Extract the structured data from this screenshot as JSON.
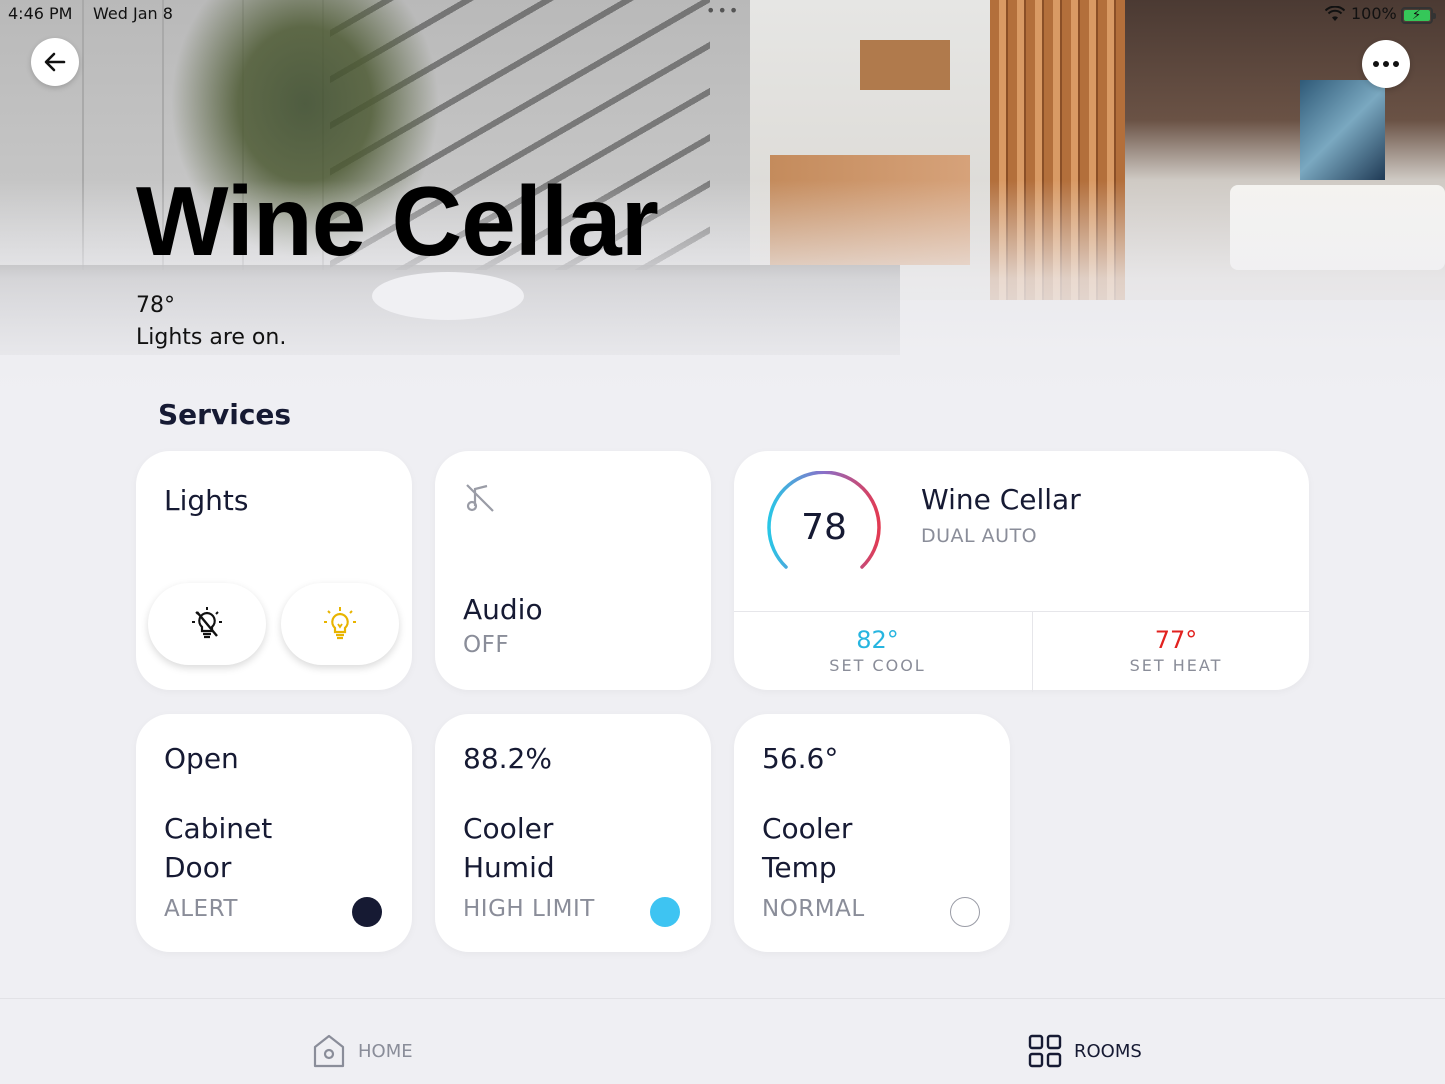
{
  "status_bar": {
    "time": "4:46 PM",
    "date": "Wed Jan 8",
    "battery": "100%",
    "battery_level": 1.0,
    "multitask_dots": "•••"
  },
  "room": {
    "title": "Wine Cellar",
    "temperature": "78°",
    "status": "Lights are on."
  },
  "section_title": "Services",
  "cards": {
    "lights": {
      "title": "Lights",
      "off_icon": "bulb-off-icon",
      "on_icon": "bulb-on-icon",
      "on_color": "#e8b400"
    },
    "audio": {
      "icon": "music-off-icon",
      "title": "Audio",
      "state": "OFF"
    },
    "thermostat": {
      "current": "78",
      "name": "Wine Cellar",
      "mode": "DUAL AUTO",
      "cool_value": "82°",
      "cool_label": "SET COOL",
      "cool_color": "#27b5e0",
      "heat_value": "77°",
      "heat_label": "SET HEAT",
      "heat_color": "#e2221f"
    },
    "cabinet_door": {
      "value": "Open",
      "title_line1": "Cabinet",
      "title_line2": "Door",
      "status": "ALERT",
      "dot_color": "#161a33"
    },
    "cooler_humid": {
      "value": "88.2%",
      "title_line1": "Cooler",
      "title_line2": "Humid",
      "status": "HIGH LIMIT",
      "dot_color": "#3ec4f2"
    },
    "cooler_temp": {
      "value": "56.6°",
      "title_line1": "Cooler",
      "title_line2": "Temp",
      "status": "NORMAL",
      "dot_color": "#ffffff"
    }
  },
  "tabbar": {
    "home_label": "HOME",
    "home_icon": "home-icon",
    "rooms_label": "ROOMS",
    "rooms_icon": "grid-icon"
  }
}
